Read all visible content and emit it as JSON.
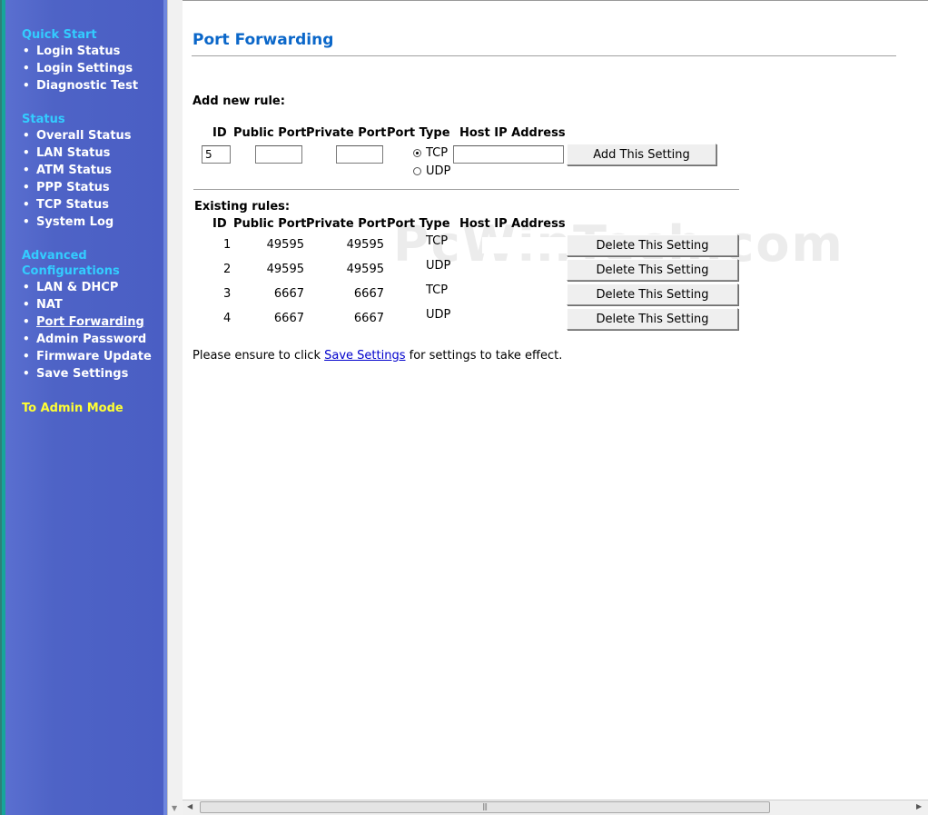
{
  "sidebar": {
    "quick_start": {
      "title": "Quick Start",
      "items": [
        "Login Status",
        "Login Settings",
        "Diagnostic Test"
      ]
    },
    "status": {
      "title": "Status",
      "items": [
        "Overall Status",
        "LAN Status",
        "ATM Status",
        "PPP Status",
        "TCP Status",
        "System Log"
      ]
    },
    "advanced": {
      "title_line1": "Advanced",
      "title_line2": "Configurations",
      "items": [
        "LAN & DHCP",
        "NAT",
        "Port Forwarding",
        "Admin Password",
        "Firmware Update",
        "Save Settings"
      ],
      "active": "Port Forwarding"
    },
    "admin_mode": "To Admin Mode",
    "bullet": "•"
  },
  "main": {
    "title": "Port Forwarding",
    "add_rule": {
      "heading": "Add new rule:",
      "columns": {
        "id": "ID",
        "public_port": "Public Port",
        "private_port": "Private Port",
        "port_type": "Port Type",
        "host_ip": "Host IP Address"
      },
      "id_value": "5",
      "public_port_value": "",
      "private_port_value": "",
      "host_ip_value": "",
      "port_type_options": [
        "TCP",
        "UDP"
      ],
      "port_type_selected": "TCP",
      "add_button": "Add This Setting"
    },
    "existing": {
      "heading": "Existing rules:",
      "columns": {
        "id": "ID",
        "public_port": "Public Port",
        "private_port": "Private Port",
        "port_type": "Port Type",
        "host_ip": "Host IP Address"
      },
      "rows": [
        {
          "id": "1",
          "public": "49595",
          "private": "49595",
          "type": "TCP",
          "delete": "Delete This Setting"
        },
        {
          "id": "2",
          "public": "49595",
          "private": "49595",
          "type": "UDP",
          "delete": "Delete This Setting"
        },
        {
          "id": "3",
          "public": "6667",
          "private": "6667",
          "type": "TCP",
          "delete": "Delete This Setting"
        },
        {
          "id": "4",
          "public": "6667",
          "private": "6667",
          "type": "UDP",
          "delete": "Delete This Setting"
        }
      ]
    },
    "note": {
      "before": "Please ensure to click ",
      "link": "Save Settings",
      "after": " for settings to take effect."
    },
    "watermark": "PcWinTech.com"
  },
  "colors": {
    "sidebar_bg": "#4a5ec4",
    "section_title": "#33ccff",
    "admin_mode": "#ffff33",
    "page_title": "#0b67c9",
    "link": "#0000cc"
  }
}
